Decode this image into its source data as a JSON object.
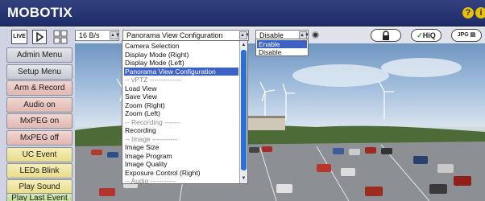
{
  "brand": "MOBOTIX",
  "title_icons": [
    "help-icon",
    "info-icon"
  ],
  "view_buttons": {
    "live": "LIVE",
    "play": "play-icon",
    "grid": "grid-icon"
  },
  "side_buttons": [
    {
      "label": "Admin Menu",
      "color": "grey"
    },
    {
      "label": "Setup Menu",
      "color": "grey"
    },
    {
      "label": "Arm & Record",
      "color": "red"
    },
    {
      "label": "Audio on",
      "color": "red"
    },
    {
      "label": "MxPEG on",
      "color": "red"
    },
    {
      "label": "MxPEG off",
      "color": "red"
    },
    {
      "label": "UC Event",
      "color": "yellow"
    },
    {
      "label": "LEDs Blink",
      "color": "yellow"
    },
    {
      "label": "Play Sound",
      "color": "yellow"
    },
    {
      "label": "Play Last Event",
      "color": "green"
    }
  ],
  "controls": {
    "framerate": "16 B/s",
    "menu_select": "Panorama View Configuration",
    "disable_select": "Disable",
    "lock_icon": "lock-icon",
    "hiq_label": "HiQ",
    "jpg_label": "JPG"
  },
  "menu_options": [
    {
      "label": "Camera Selection",
      "kind": "item"
    },
    {
      "label": "Display Mode (Right)",
      "kind": "item"
    },
    {
      "label": "Display Mode (Left)",
      "kind": "item"
    },
    {
      "label": "Panorama View Configuration",
      "kind": "selected"
    },
    {
      "label": "-- vPTZ --------------",
      "kind": "header"
    },
    {
      "label": "Load View",
      "kind": "item"
    },
    {
      "label": "Save View",
      "kind": "item"
    },
    {
      "label": "Zoom (Right)",
      "kind": "item"
    },
    {
      "label": "Zoom (Left)",
      "kind": "item"
    },
    {
      "label": "-- Recording -------",
      "kind": "header"
    },
    {
      "label": "Recording",
      "kind": "item"
    },
    {
      "label": "-- Image -----------",
      "kind": "header"
    },
    {
      "label": "Image Size",
      "kind": "item"
    },
    {
      "label": "Image Program",
      "kind": "item"
    },
    {
      "label": "Image Quality",
      "kind": "item"
    },
    {
      "label": "Exposure Control (Right)",
      "kind": "item"
    },
    {
      "label": "-- Audio -----------",
      "kind": "header"
    }
  ],
  "enable_options": [
    {
      "label": "Enable",
      "kind": "selected"
    },
    {
      "label": "Disable",
      "kind": "item"
    }
  ],
  "colors": {
    "titlebar": "#27357a",
    "selection": "#3b62c4",
    "panel": "#cfd3e4"
  }
}
